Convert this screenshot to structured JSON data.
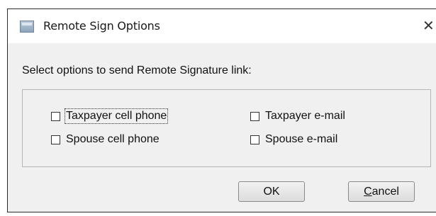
{
  "window": {
    "title": "Remote Sign Options",
    "close_glyph": "✕",
    "app_icon": "window-icon"
  },
  "prompt": "Select options to send Remote Signature link:",
  "options": [
    {
      "label": "Taxpayer cell phone",
      "checked": false
    },
    {
      "label": "Taxpayer e-mail",
      "checked": false
    },
    {
      "label": "Spouse cell phone",
      "checked": false
    },
    {
      "label": "Spouse e-mail",
      "checked": false
    }
  ],
  "buttons": {
    "ok": "OK",
    "cancel_mnemonic": "C",
    "cancel_rest": "ancel"
  }
}
